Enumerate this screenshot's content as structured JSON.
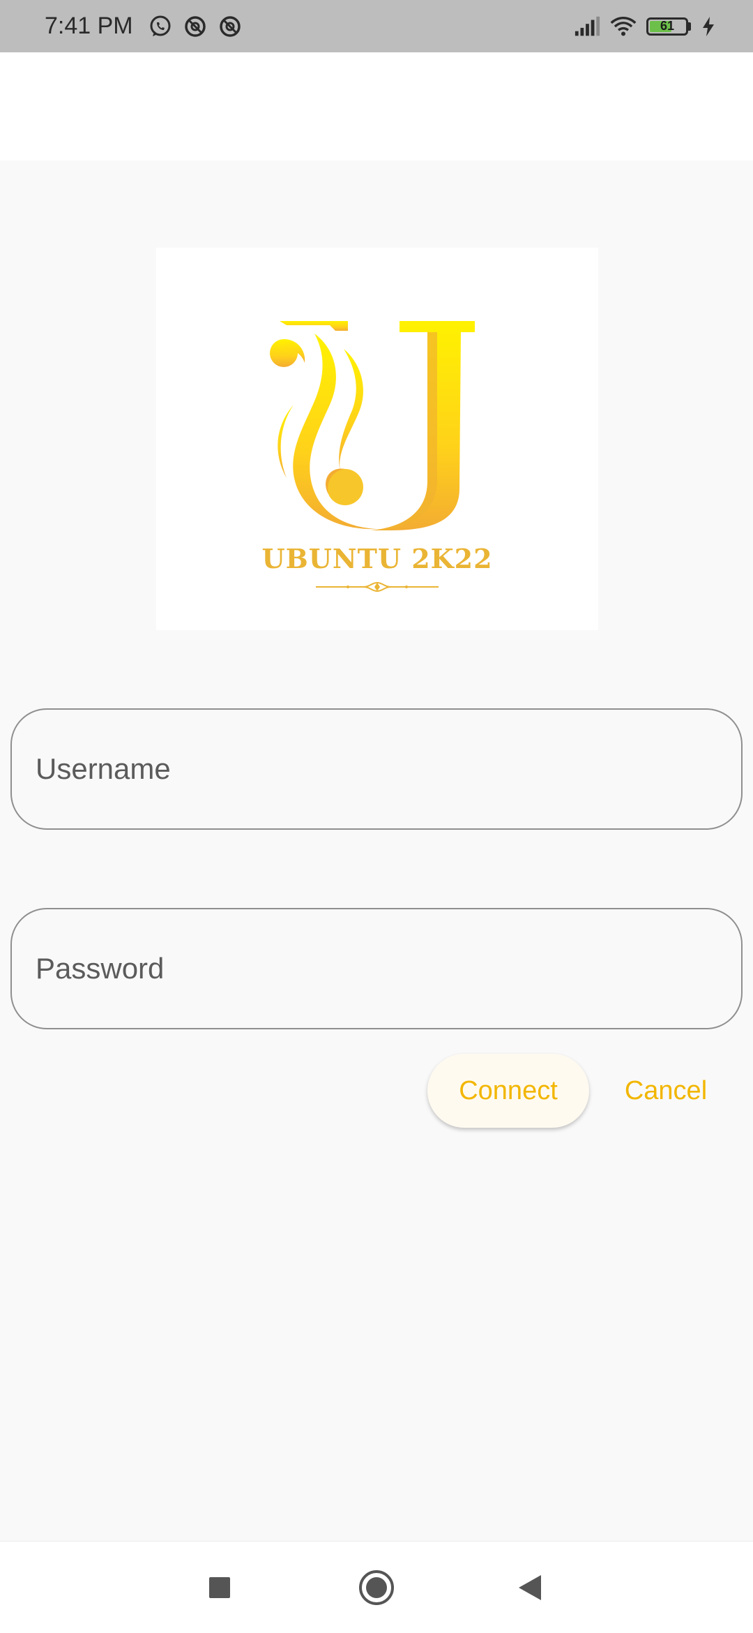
{
  "status_bar": {
    "time": "7:41 PM",
    "left_icons": [
      "whatsapp-icon",
      "notification-icon",
      "notification-icon"
    ],
    "right_icons": [
      "signal-icon",
      "wifi-icon"
    ],
    "battery_level": "61",
    "battery_percent": 61,
    "charging": true
  },
  "logo": {
    "text": "UBUNTU 2K22"
  },
  "form": {
    "username_placeholder": "Username",
    "password_placeholder": "Password",
    "connect_label": "Connect",
    "cancel_label": "Cancel"
  },
  "nav_bar": {
    "buttons": [
      "recents",
      "home",
      "back"
    ]
  },
  "colors": {
    "accent": "#f2b600",
    "logo_gold": "#eab434",
    "logo_yellow": "#ffe600",
    "background": "#f9f9f9"
  }
}
